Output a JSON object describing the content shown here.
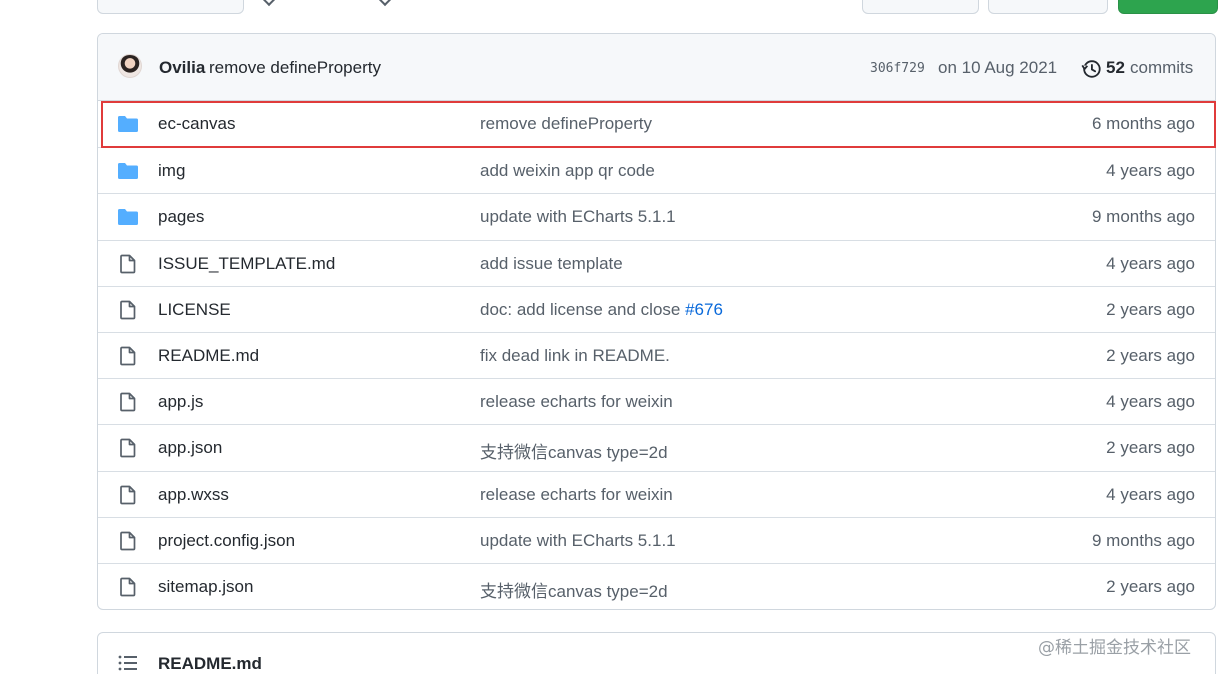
{
  "commit_bar": {
    "author": "Ovilia",
    "message": "remove defineProperty",
    "sha": "306f729",
    "date": "on 10 Aug 2021",
    "commit_count": "52",
    "commit_count_label": "commits"
  },
  "files": [
    {
      "type": "folder",
      "name": "ec-canvas",
      "message": "remove defineProperty",
      "link": "",
      "age": "6 months ago",
      "highlighted": true
    },
    {
      "type": "folder",
      "name": "img",
      "message": "add weixin app qr code",
      "link": "",
      "age": "4 years ago"
    },
    {
      "type": "folder",
      "name": "pages",
      "message": "update with ECharts 5.1.1",
      "link": "",
      "age": "9 months ago"
    },
    {
      "type": "file",
      "name": "ISSUE_TEMPLATE.md",
      "message": "add issue template",
      "link": "",
      "age": "4 years ago"
    },
    {
      "type": "file",
      "name": "LICENSE",
      "message": "doc: add license and close ",
      "link": "#676",
      "age": "2 years ago"
    },
    {
      "type": "file",
      "name": "README.md",
      "message": "fix dead link in README.",
      "link": "",
      "age": "2 years ago"
    },
    {
      "type": "file",
      "name": "app.js",
      "message": "release echarts for weixin",
      "link": "",
      "age": "4 years ago"
    },
    {
      "type": "file",
      "name": "app.json",
      "message": "支持微信canvas type=2d",
      "link": "",
      "age": "2 years ago"
    },
    {
      "type": "file",
      "name": "app.wxss",
      "message": "release echarts for weixin",
      "link": "",
      "age": "4 years ago"
    },
    {
      "type": "file",
      "name": "project.config.json",
      "message": "update with ECharts 5.1.1",
      "link": "",
      "age": "9 months ago"
    },
    {
      "type": "file",
      "name": "sitemap.json",
      "message": "支持微信canvas type=2d",
      "link": "",
      "age": "2 years ago"
    }
  ],
  "readme": {
    "title": "README.md"
  },
  "watermark": "@稀土掘金技术社区",
  "colors": {
    "folder_icon": "#54aeff",
    "file_icon": "#57606a",
    "link": "#0969da",
    "highlight_border": "#e03b3b",
    "header_bg": "#f6f8fa"
  }
}
